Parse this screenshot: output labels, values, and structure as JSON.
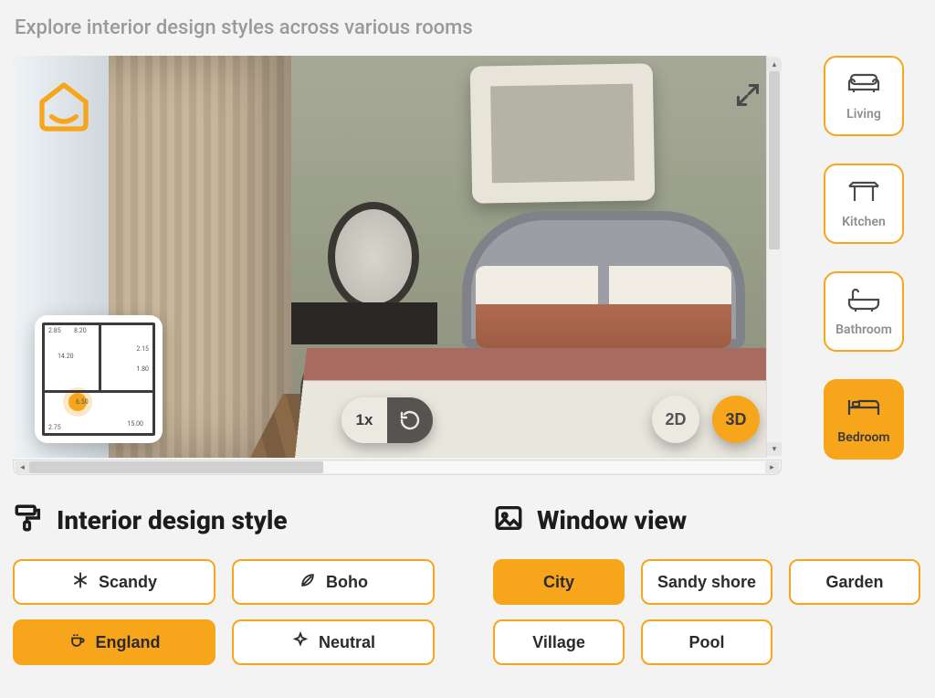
{
  "subtitle": "Explore interior design styles across various rooms",
  "colors": {
    "accent": "#f7a51b"
  },
  "preview": {
    "zoom_label": "1x",
    "rotate_icon": "rotate-icon",
    "view2d_label": "2D",
    "view3d_label": "3D",
    "active_view": "3D"
  },
  "floorplan": {
    "labels": {
      "tl1": "2.85",
      "tl2": "8.20",
      "mid": "14.20",
      "r1": "2.15",
      "r2": "1.80",
      "marker": "6.50",
      "br": "15.00",
      "bl": "2.75"
    }
  },
  "rooms": [
    {
      "label": "Living",
      "icon": "sofa-icon",
      "active": false
    },
    {
      "label": "Kitchen",
      "icon": "table-icon",
      "active": false
    },
    {
      "label": "Bathroom",
      "icon": "bathtub-icon",
      "active": false
    },
    {
      "label": "Bedroom",
      "icon": "bed-icon",
      "active": true
    }
  ],
  "style_panel": {
    "title": "Interior design style",
    "options": [
      {
        "label": "Scandy",
        "icon": "snowflake-icon",
        "active": false
      },
      {
        "label": "Boho",
        "icon": "leaf-icon",
        "active": false
      },
      {
        "label": "England",
        "icon": "cup-icon",
        "active": true
      },
      {
        "label": "Neutral",
        "icon": "sparkle-icon",
        "active": false
      }
    ]
  },
  "view_panel": {
    "title": "Window view",
    "options": [
      {
        "label": "City",
        "active": true
      },
      {
        "label": "Sandy shore",
        "active": false
      },
      {
        "label": "Garden",
        "active": false
      },
      {
        "label": "Village",
        "active": false
      },
      {
        "label": "Pool",
        "active": false
      }
    ]
  }
}
